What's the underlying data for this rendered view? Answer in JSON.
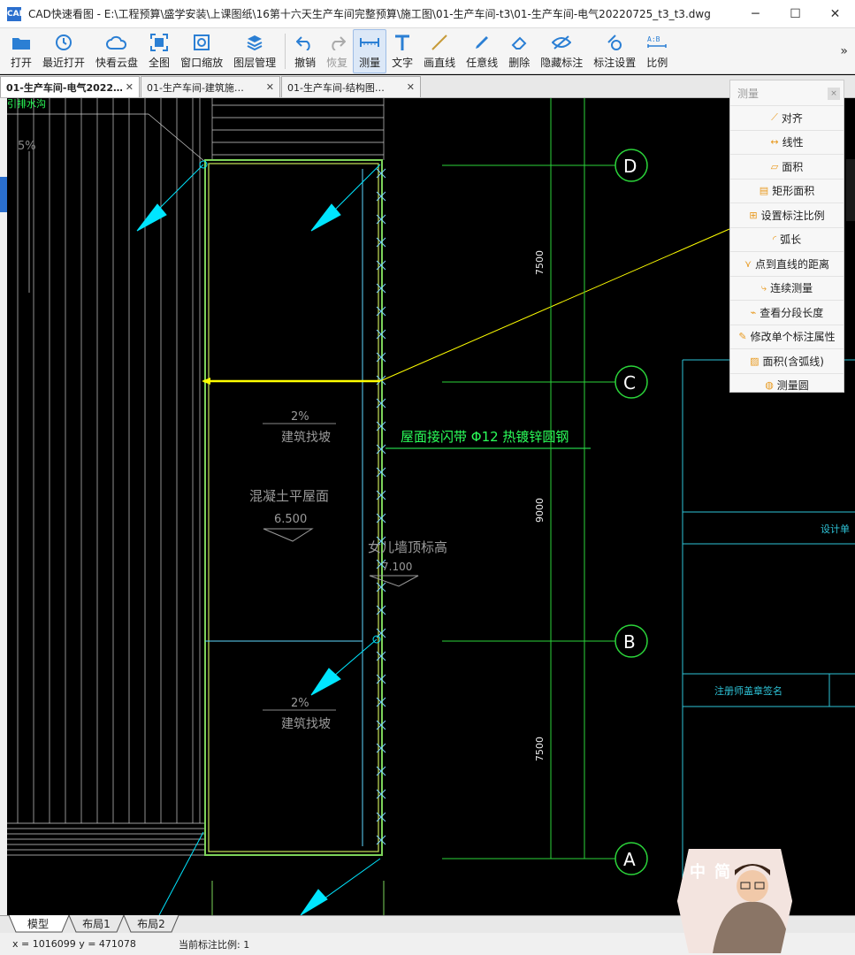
{
  "window": {
    "app_icon": "CAD",
    "title": "CAD快速看图 - E:\\工程预算\\盛学安装\\上课图纸\\16第十六天生产车间完整预算\\施工图\\01-生产车间-t3\\01-生产车间-电气20220725_t3_t3.dwg",
    "minimize": "─",
    "maximize": "☐",
    "close": "✕"
  },
  "toolbar": {
    "open": "打开",
    "recent": "最近打开",
    "cloud": "快看云盘",
    "fit": "全图",
    "window_zoom": "窗口缩放",
    "layers": "图层管理",
    "undo": "撤销",
    "redo": "恢复",
    "measure": "测量",
    "text": "文字",
    "line": "画直线",
    "freeline": "任意线",
    "erase": "删除",
    "hide_dim": "隐藏标注",
    "dim_settings": "标注设置",
    "scale": "比例",
    "more": "»"
  },
  "tabs": [
    {
      "label": "01-生产车间-电气2022…",
      "close": "✕"
    },
    {
      "label": "01-生产车间-建筑施…",
      "close": "✕"
    },
    {
      "label": "01-生产车间-结构图…",
      "close": "✕"
    }
  ],
  "measure_panel": {
    "title": "测量",
    "close": "×",
    "items": [
      "对齐",
      "线性",
      "面积",
      "矩形面积",
      "设置标注比例",
      "弧长",
      "点到直线的距离",
      "连续测量",
      "查看分段长度",
      "修改单个标注属性",
      "面积(含弧线)",
      "测量圆"
    ]
  },
  "drawing": {
    "top_left_label": "引排水沟",
    "slope_5": "5%",
    "slope_2a": "2%",
    "slope_2b": "2%",
    "build_slope_a": "建筑找坡",
    "build_slope_b": "建筑找坡",
    "concrete_roof": "混凝土平屋面",
    "elev_650": "6.500",
    "parapet": "女儿墙顶标高",
    "elev_710": "7.100",
    "lightning": "屋面接闪带 Φ12 热镀锌圆钢",
    "dim_7500_top": "7500",
    "dim_9000": "9000",
    "dim_7500_bot": "7500",
    "axis_d": "D",
    "axis_c": "C",
    "axis_b": "B",
    "axis_a": "A",
    "design_unit": "设计单",
    "sign_box": "注册师盖章签名"
  },
  "layout_tabs": [
    "模型",
    "布局1",
    "布局2"
  ],
  "status": {
    "coords": "x = 1016099  y = 471078",
    "scale": "当前标注比例: 1"
  },
  "avatar": {
    "text": "中简"
  }
}
